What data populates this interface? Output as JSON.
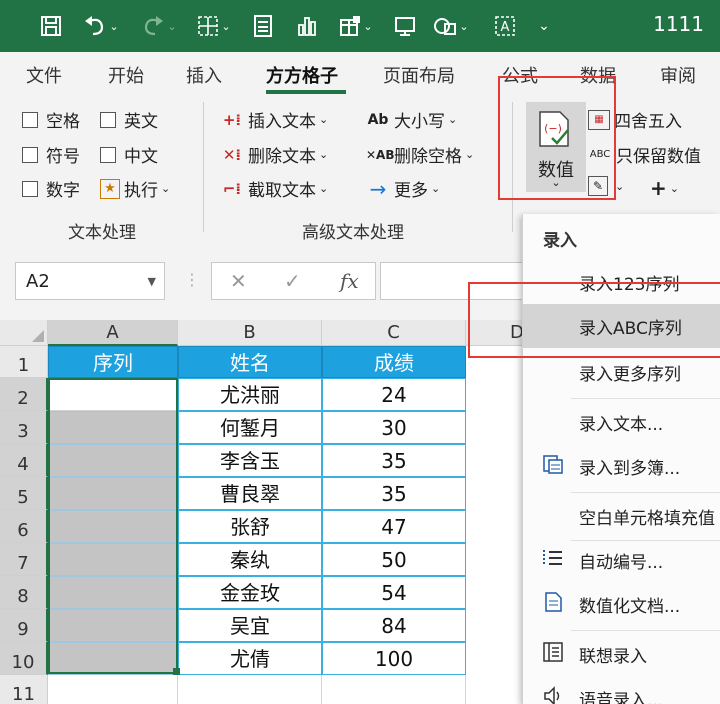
{
  "window": {
    "title": "1111"
  },
  "ribbon_tabs": [
    "文件",
    "开始",
    "插入",
    "方方格子",
    "页面布局",
    "公式",
    "数据",
    "审阅"
  ],
  "text_processing": {
    "options": [
      "空格",
      "英文",
      "符号",
      "中文",
      "数字"
    ],
    "execute_label": "执行",
    "group_label": "文本处理"
  },
  "advanced_text": {
    "items": [
      "插入文本",
      "删除文本",
      "截取文本",
      "大小写",
      "删除空格",
      "更多"
    ],
    "group_label": "高级文本处理"
  },
  "numeric": {
    "button_label": "数值",
    "items": [
      "四舍五入",
      "只保留数值"
    ],
    "plus": "+",
    "icon_text": "(−)"
  },
  "formula_bar": {
    "name_box": "A2",
    "cancel": "✕",
    "confirm": "✓",
    "fx": "fx"
  },
  "sheet": {
    "columns": [
      "A",
      "B",
      "C",
      "D"
    ],
    "rows": [
      "1",
      "2",
      "3",
      "4",
      "5",
      "6",
      "7",
      "8",
      "9",
      "10",
      "11"
    ],
    "headers": [
      "序列",
      "姓名",
      "成绩"
    ],
    "data": [
      [
        "",
        "尤洪丽",
        "24"
      ],
      [
        "",
        "何錾月",
        "30"
      ],
      [
        "",
        "李含玉",
        "35"
      ],
      [
        "",
        "曹良翠",
        "35"
      ],
      [
        "",
        "张舒",
        "47"
      ],
      [
        "",
        "秦纨",
        "50"
      ],
      [
        "",
        "金金玫",
        "54"
      ],
      [
        "",
        "吴宜",
        "84"
      ],
      [
        "",
        "尤倩",
        "100"
      ]
    ]
  },
  "dropdown": {
    "header": "录入",
    "items": [
      "录入123序列",
      "录入ABC序列",
      "录入更多序列",
      "录入文本...",
      "录入到多簿...",
      "空白单元格填充值",
      "自动编号...",
      "数值化文档...",
      "联想录入",
      "语音录入..."
    ],
    "highlighted": "录入ABC序列"
  },
  "colors": {
    "excel_green": "#217346",
    "header_fill": "#1da1df",
    "highlight_red": "#e53935"
  }
}
